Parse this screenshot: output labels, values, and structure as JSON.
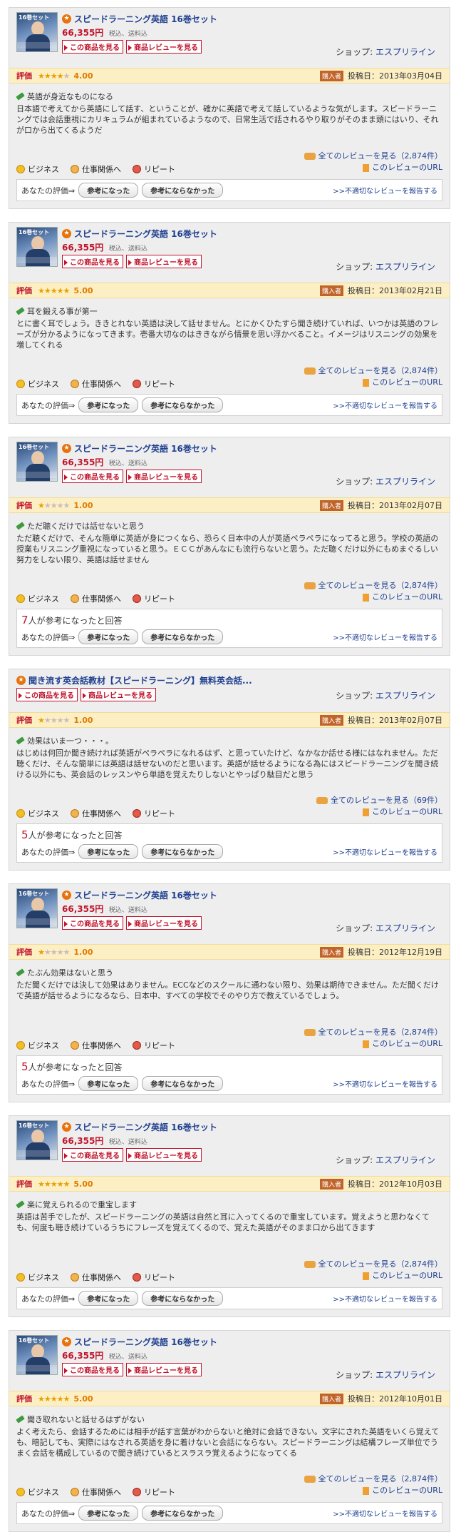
{
  "labels": {
    "view_product": "この商品を見る",
    "view_reviews": "商品レビューを見る",
    "shop_label": "ショップ: ",
    "rating_label": "評価",
    "purchaser_badge": "購入者",
    "posted_prefix": "投稿日：",
    "eval_label": "あなたの評価⇒",
    "helpful_btn": "参考になった",
    "not_helpful_btn": "参考にならなかった",
    "report_link": ">>不適切なレビューを報告する",
    "review_url": "このレビューのURL",
    "helpful_suffix": "人が参考になったと回答",
    "tags": [
      "ビジネス",
      "仕事関係へ",
      "リピート"
    ]
  },
  "reviews": [
    {
      "product_title": "スピードラーニング英語 16巻セット",
      "has_image": true,
      "thumb_text": "16巻セット",
      "price": "66,355円",
      "tax": "税込、送料込",
      "shop": "エスプリライン",
      "stars": 4,
      "score": "4.00",
      "date": "2013年03月04日",
      "title": "英語が身近なものになる",
      "body": "日本語で考えてから英語にして話す、ということが、確かに英語で考えて話しているような気がします。スピードラーニングでは会話重視にカリキュラムが組まれているようなので、日常生活で話されるやり取りがそのまま頭にはいり、それが口から出てくるようだ",
      "all_reviews": "全てのレビューを見る（2,874件）",
      "helpful_count": ""
    },
    {
      "product_title": "スピードラーニング英語 16巻セット",
      "has_image": true,
      "thumb_text": "16巻セット",
      "price": "66,355円",
      "tax": "税込、送料込",
      "shop": "エスプリライン",
      "stars": 5,
      "score": "5.00",
      "date": "2013年02月21日",
      "title": "耳を鍛える事が第一",
      "body": "とに書く耳でしょう。ききとれない英語は決して話せません。とにかくひたすら聞き続けていれば、いつかは英語のフレーズが分かるようになってきます。壱番大切なのはききながら情景を思い浮かべること。イメージはリスニングの効果を増してくれる",
      "all_reviews": "全てのレビューを見る（2,874件）",
      "helpful_count": ""
    },
    {
      "product_title": "スピードラーニング英語 16巻セット",
      "has_image": true,
      "thumb_text": "16巻セット",
      "price": "66,355円",
      "tax": "税込、送料込",
      "shop": "エスプリライン",
      "stars": 1,
      "score": "1.00",
      "date": "2013年02月07日",
      "title": "ただ聴くだけでは話せないと思う",
      "body": "ただ聴くだけで、そんな簡単に英語が身につくなら、恐らく日本中の人が英語ペラペラになってると思う。学校の英語の授業もリスニング重視になっていると思う。ＥＣＣがあんなにも流行らないと思う。ただ聴くだけ以外にもめまぐるしい努力をしない限り、英語は話せません",
      "all_reviews": "全てのレビューを見る（2,874件）",
      "helpful_count": "7"
    },
    {
      "product_title": "聞き流す英会話教材【スピードラーニング】無料英会話...",
      "has_image": false,
      "thumb_text": "",
      "price": "",
      "tax": "",
      "shop": "エスプリライン",
      "stars": 1,
      "score": "1.00",
      "date": "2013年02月07日",
      "title": "効果はいま一つ・・・。",
      "body": "はじめは何回か聞き続ければ英語がペラペラになれるはず、と思っていたけど、なかなか話せる様にはなれません。ただ聴くだけ、そんな簡単には英語は話せないのだと思います。英語が話せるようになる為にはスピードラーニングを聞き続ける以外にも、英会話のレッスンやら単語を覚えたりしないとやっぱり駄目だと思う",
      "all_reviews": "全てのレビューを見る（69件）",
      "helpful_count": "5"
    },
    {
      "product_title": "スピードラーニング英語 16巻セット",
      "has_image": true,
      "thumb_text": "16巻セット",
      "price": "66,355円",
      "tax": "税込、送料込",
      "shop": "エスプリライン",
      "stars": 1,
      "score": "1.00",
      "date": "2012年12月19日",
      "title": "たぶん効果はないと思う",
      "body": "ただ聞くだけでは決して効果はありません。ECCなどのスクールに通わない限り、効果は期待できません。ただ聞くだけで英語が話せるようになるなら、日本中、すべての学校でそのやり方で教えているでしょう。",
      "all_reviews": "全てのレビューを見る（2,874件）",
      "helpful_count": "5"
    },
    {
      "product_title": "スピードラーニング英語 16巻セット",
      "has_image": true,
      "thumb_text": "16巻セット",
      "price": "66,355円",
      "tax": "税込、送料込",
      "shop": "エスプリライン",
      "stars": 5,
      "score": "5.00",
      "date": "2012年10月03日",
      "title": "楽に覚えられるので重宝します",
      "body": "英語は苦手でしたが、スピードラーニングの英語は自然と耳に入ってくるので重宝しています。覚えようと思わなくても、何度も聴き続けているうちにフレーズを覚えてくるので、覚えた英語がそのまま口から出てきます",
      "all_reviews": "全てのレビューを見る（2,874件）",
      "helpful_count": ""
    },
    {
      "product_title": "スピードラーニング英語 16巻セット",
      "has_image": true,
      "thumb_text": "16巻セット",
      "price": "66,355円",
      "tax": "税込、送料込",
      "shop": "エスプリライン",
      "stars": 5,
      "score": "5.00",
      "date": "2012年10月01日",
      "title": "聞き取れないと話せるはずがない",
      "body": "よく考えたら、会話するためには相手が話す言葉がわからないと絶対に会話できない。文字にされた英語をいくら覚えても、暗記しても、実際にはなされる英語を身に着けないと会話にならない。スピードラーニングは結構フレーズ単位でうまく会話を構成しているので聞き続けているとスラスラ覚えるようになってくる",
      "all_reviews": "全てのレビューを見る（2,874件）",
      "helpful_count": ""
    }
  ]
}
